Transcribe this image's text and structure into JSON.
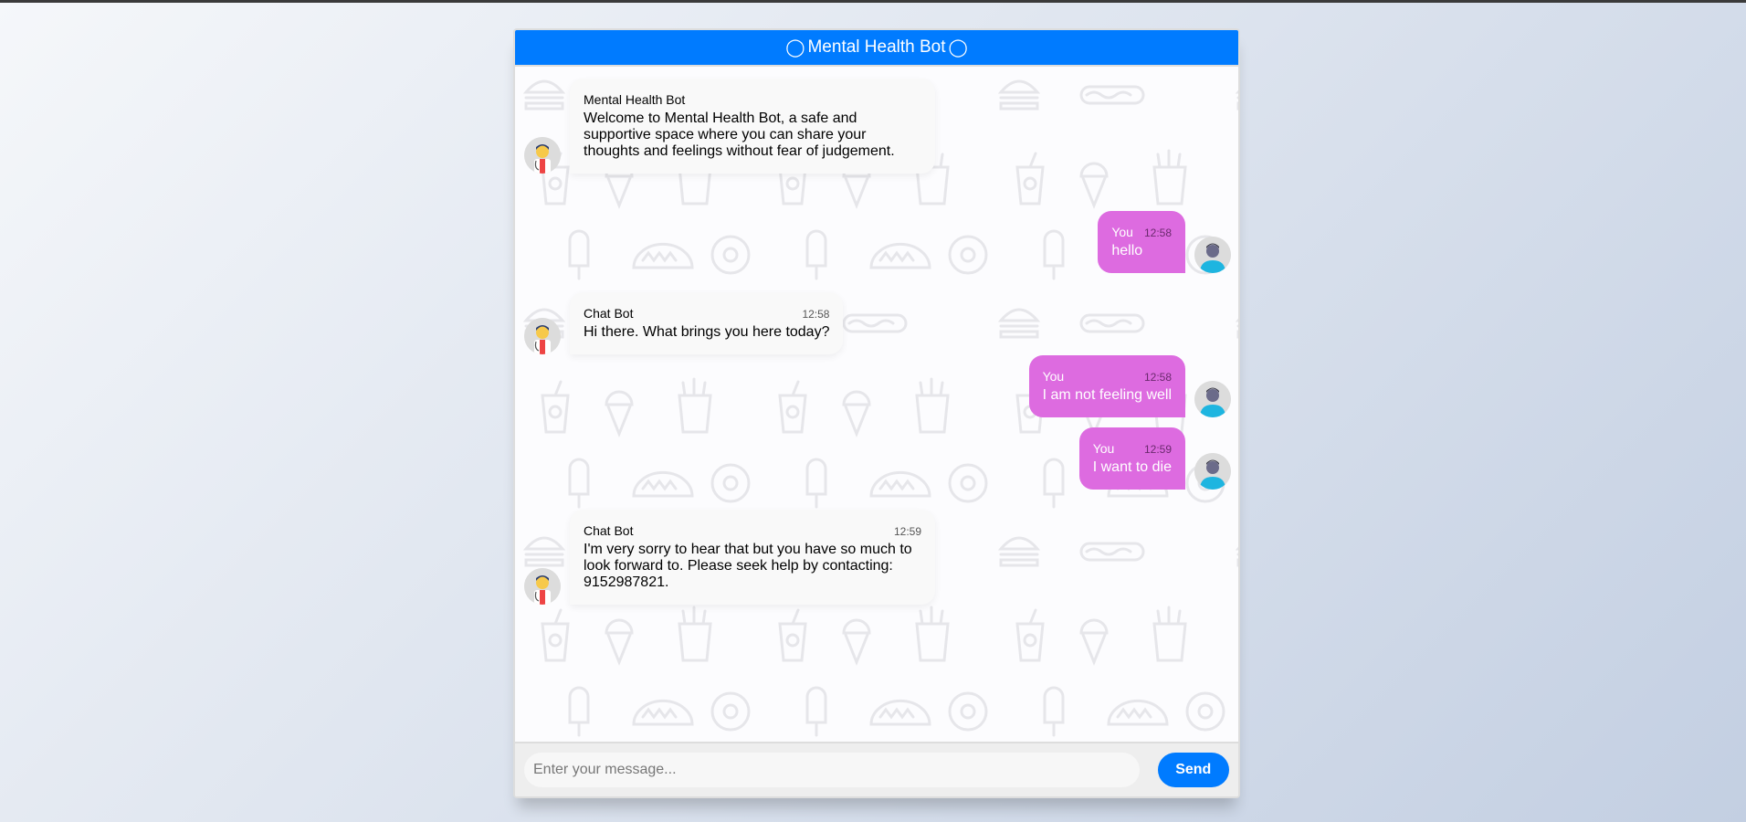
{
  "app": {
    "title": "Mental Health Bot",
    "title_icon": "circle-outline-icon",
    "colors": {
      "header": "#007bff",
      "user_bubble": "#dd6be0",
      "bot_bubble": "#f9f9f9",
      "send_button": "#007bff"
    }
  },
  "messages": [
    {
      "sender": "bot",
      "name": "Mental Health Bot",
      "time": "",
      "avatar": "doctor-avatar-icon",
      "text": "Welcome to Mental Health Bot, a safe and supportive space where you can share your thoughts and feelings without fear of judgement."
    },
    {
      "sender": "user",
      "name": "You",
      "time": "12:58",
      "avatar": "user-avatar-icon",
      "text": "hello"
    },
    {
      "sender": "bot",
      "name": "Chat Bot",
      "time": "12:58",
      "avatar": "doctor-avatar-icon",
      "text": "Hi there. What brings you here today?"
    },
    {
      "sender": "user",
      "name": "You",
      "time": "12:58",
      "avatar": "user-avatar-icon",
      "text": "I am not feeling well"
    },
    {
      "sender": "user",
      "name": "You",
      "time": "12:59",
      "avatar": "user-avatar-icon",
      "text": "I want to die"
    },
    {
      "sender": "bot",
      "name": "Chat Bot",
      "time": "12:59",
      "avatar": "doctor-avatar-icon",
      "text": "I'm very sorry to hear that but you have so much to look forward to. Please seek help by contacting: 9152987821."
    }
  ],
  "composer": {
    "placeholder": "Enter your message...",
    "value": "",
    "send_label": "Send"
  }
}
